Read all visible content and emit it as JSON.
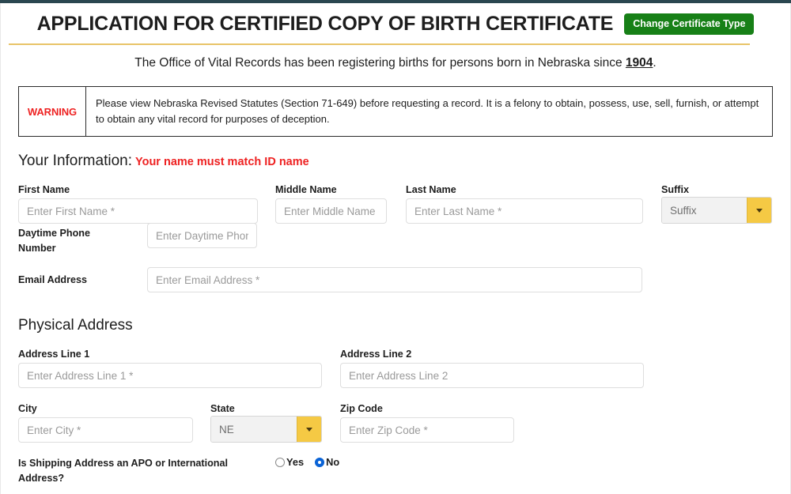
{
  "header": {
    "title": "APPLICATION FOR CERTIFIED COPY OF BIRTH CERTIFICATE",
    "change_type_label": "Change Certificate Type",
    "button_color": "#178017",
    "rule_color": "#e8c468",
    "topbar_color": "#2b4750"
  },
  "subtitle": {
    "before": "The Office of Vital Records has been registering births for persons born in Nebraska since ",
    "year": "1904",
    "after": "."
  },
  "warning": {
    "label": "WARNING",
    "label_color": "#ee2222",
    "text": "Please view Nebraska Revised Statutes (Section 71-649) before requesting a record. It is a felony to obtain, possess, use, sell, furnish, or attempt to obtain any vital record for purposes of deception."
  },
  "your_information": {
    "heading": "Your Information:",
    "note": "Your name must match ID name",
    "note_color": "#ee2222",
    "fields": {
      "first_name": {
        "label": "First Name",
        "placeholder": "Enter First Name *",
        "value": ""
      },
      "middle_name": {
        "label": "Middle Name",
        "placeholder": "Enter Middle Name",
        "value": ""
      },
      "last_name": {
        "label": "Last Name",
        "placeholder": "Enter Last Name *",
        "value": ""
      },
      "suffix": {
        "label": "Suffix",
        "selected": "Suffix"
      },
      "daytime_phone": {
        "label_line1": "Daytime Phone",
        "label_line2": "Number",
        "placeholder": "Enter Daytime Phone",
        "value": ""
      },
      "email": {
        "label": "Email Address",
        "placeholder": "Enter Email Address *",
        "value": ""
      }
    }
  },
  "physical_address": {
    "heading": "Physical Address",
    "fields": {
      "address_line_1": {
        "label": "Address Line 1",
        "placeholder": "Enter Address Line 1 *",
        "value": ""
      },
      "address_line_2": {
        "label": "Address Line 2",
        "placeholder": "Enter Address Line 2",
        "value": ""
      },
      "city": {
        "label": "City",
        "placeholder": "Enter City *",
        "value": ""
      },
      "state": {
        "label": "State",
        "selected": "NE"
      },
      "zip_code": {
        "label": "Zip Code",
        "placeholder": "Enter Zip Code *",
        "value": ""
      }
    },
    "apo_question": {
      "label_line1": "Is Shipping Address an APO or International",
      "label_line2": "Address?",
      "options": [
        {
          "label": "Yes",
          "selected": false
        },
        {
          "label": "No",
          "selected": true
        }
      ],
      "selected_color": "#0a63d6"
    }
  }
}
